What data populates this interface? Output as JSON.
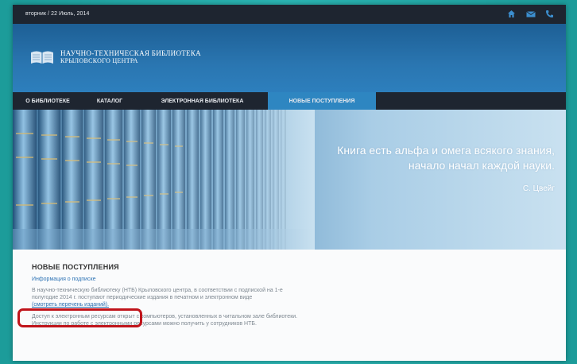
{
  "topbar": {
    "date": "вторник / 22 Июль, 2014",
    "icons": [
      "home-icon",
      "mail-icon",
      "phone-icon"
    ]
  },
  "header": {
    "logo_line1": "НАУЧНО-ТЕХНИЧЕСКАЯ БИБЛИОТЕКА",
    "logo_line2": "КРЫЛОВСКОГО ЦЕНТРА"
  },
  "nav": {
    "items": [
      {
        "label": "О БИБЛИОТЕКЕ"
      },
      {
        "label": "КАТАЛОГ"
      },
      {
        "label": "ЭЛЕКТРОННАЯ БИБЛИОТЕКА"
      },
      {
        "label": "НОВЫЕ ПОСТУПЛЕНИЯ"
      }
    ],
    "active_index": 3
  },
  "hero": {
    "quote_line1": "Книга есть альфа и омега всякого знания,",
    "quote_line2": "начало начал каждой науки.",
    "author": "С. Цвейг"
  },
  "content": {
    "heading": "НОВЫЕ ПОСТУПЛЕНИЯ",
    "subheading": "Информация о подписке",
    "para1_line1": "В научно-техническую библиотеку (НТБ) Крыловского центра, в соответствии с подпиской на 1-е",
    "para1_line2": "полугодие 2014 г. поступают периодические издания в печатном и электронном виде",
    "link": "(смотреть перечень изданий).",
    "para2_line1": "Доступ к электронным ресурсам открыт с компьютеров, установленных в читальном зале библиотеки.",
    "para2_line2": "Инструкции по работе с электронными ресурсами можно получить у сотрудников НТБ."
  },
  "colors": {
    "accent": "#2e86c1",
    "dark_bar": "#1e2530",
    "highlight": "#c0141b",
    "link": "#2a6fb1"
  }
}
